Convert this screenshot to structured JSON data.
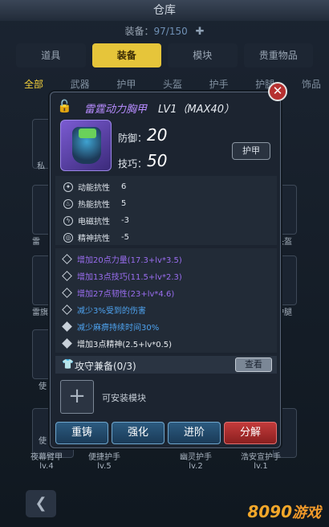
{
  "header": {
    "title": "仓库",
    "capacity_label": "装备：",
    "capacity_value": "97/150",
    "plus_icon": "gear-plus-icon"
  },
  "tabs": [
    "道具",
    "装备",
    "模块",
    "贵重物品"
  ],
  "subtabs": [
    "全部",
    "武器",
    "护甲",
    "头盔",
    "护手",
    "护腿",
    "饰品"
  ],
  "background_cells": {
    "left_labels": [
      "私",
      "雷",
      "雷旗",
      "使",
      "使"
    ],
    "right_labels": [
      "头盔",
      "护腿"
    ],
    "bottom": [
      {
        "name": "夜幕臂甲",
        "level": "lv.4"
      },
      {
        "name": "便捷护手",
        "level": "lv.5"
      },
      {
        "name": "幽灵护手",
        "level": "lv.2"
      },
      {
        "name": "浩安宣护手",
        "level": "lv.1"
      }
    ]
  },
  "dialog": {
    "item_name": "雷霆动力胸甲",
    "item_level": "LV1（MAX40）",
    "defense_label": "防御：",
    "defense_value": "20",
    "skill_label": "技巧：",
    "skill_value": "50",
    "type_button": "护甲",
    "resistances": [
      {
        "label": "动能抗性",
        "value": "6"
      },
      {
        "label": "热能抗性",
        "value": "5"
      },
      {
        "label": "电磁抗性",
        "value": "-3"
      },
      {
        "label": "精神抗性",
        "value": "-5"
      }
    ],
    "bonuses": [
      {
        "text": "增加20点力量(17.3+lv*3.5)",
        "color": "#9a6df0"
      },
      {
        "text": "增加13点技巧(11.5+lv*2.3)",
        "color": "#9a6df0"
      },
      {
        "text": "增加27点韧性(23+lv*4.6)",
        "color": "#9a6df0"
      },
      {
        "text": "减少3%受到的伤害",
        "color": "#4ea3f0"
      },
      {
        "text": "减少麻痹持续时间30%",
        "color": "#4ea3f0"
      },
      {
        "text": "增加3点精神(2.5+lv*0.5)",
        "color": "#e8ecf0"
      }
    ],
    "set_label": "攻守兼备(0/3)",
    "view_button": "查看",
    "module_text": "可安装模块",
    "actions": [
      "重铸",
      "强化",
      "进阶",
      "分解"
    ]
  },
  "logo": {
    "number": "8090",
    "suffix": "游戏"
  }
}
